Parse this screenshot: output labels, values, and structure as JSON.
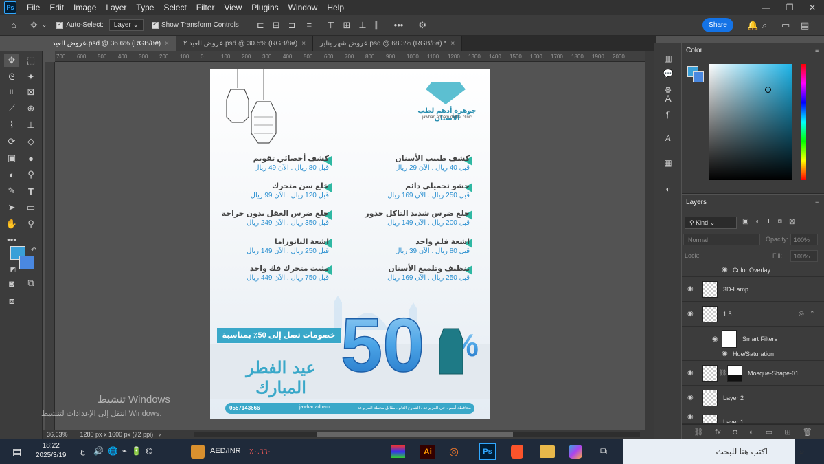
{
  "app": {
    "menu": [
      "File",
      "Edit",
      "Image",
      "Layer",
      "Type",
      "Select",
      "Filter",
      "View",
      "Plugins",
      "Window",
      "Help"
    ],
    "logo": "Ps"
  },
  "options": {
    "auto_select": "Auto-Select:",
    "target": "Layer",
    "transform": "Show Transform Controls",
    "more": "•••",
    "share": "Share"
  },
  "tabs": [
    {
      "label": "عروض العيد.psd @ 36.6% (RGB/8#)",
      "active": true
    },
    {
      "label": "عروض العيد ٢.psd @ 30.5% (RGB/8#)",
      "active": false
    },
    {
      "label": "عروض شهر يناير.psd @ 68.3% (RGB/8#) *",
      "active": false
    }
  ],
  "ruler": [
    "700",
    "600",
    "500",
    "400",
    "300",
    "200",
    "100",
    "0",
    "100",
    "200",
    "300",
    "400",
    "500",
    "600",
    "700",
    "800",
    "900",
    "1000",
    "1100",
    "1200",
    "1300",
    "1400",
    "1500",
    "1600",
    "1700",
    "1800",
    "1900",
    "2000"
  ],
  "status": {
    "zoom": "36.63%",
    "info": "1280 px x 1600 px (72 ppi)"
  },
  "document": {
    "brand_ar": "جوهرة أدهم لطب الأسنان",
    "brand_en": "jawhart adham dental clinic",
    "offers_right": [
      {
        "title": "كشف طبيب الأسنان",
        "price": "قبل 40 ريال . الآن 29 ريال"
      },
      {
        "title": "حشو تجميلي دائم",
        "price": "قبل 250 ريال . الآن 169 ريال"
      },
      {
        "title": "خلع ضرس شديد التاكل جذور",
        "price": "قبل 200 ريال . الآن 149 ريال"
      },
      {
        "title": "اشعة فلم واحد",
        "price": "قبل 80 ريال . الآن 39 ريال"
      },
      {
        "title": "تنظيف وتلميع الأسنان",
        "price": "قبل 250 ريال . الآن 169 ريال"
      }
    ],
    "offers_left": [
      {
        "title": "كشف أخصائي تقويم",
        "price": "قبل 80 ريال . الآن 49 ريال"
      },
      {
        "title": "خلع سن متحرك",
        "price": "قبل 120 ريال . الآن 99 ريال"
      },
      {
        "title": "خلع ضرس العقل بدون جراحة",
        "price": "قبل 350 ريال . الآن 249 ريال"
      },
      {
        "title": "اشعة البانوراما",
        "price": "قبل 250 ريال . الآن 149 ريال"
      },
      {
        "title": "مثبت متحرك فك واحد",
        "price": "قبل 750 ريال . الآن 449 ريال"
      }
    ],
    "discount_banner": "خصومات تصل إلى 50٪ بمناسبة",
    "big_number": "50",
    "percent": "%",
    "eid_text": "عيد الفطر المبارك",
    "phone": "0557143666",
    "handle": "jawhartadham",
    "address": "محافظة أضم . حي المزيرعة . الشارع العام . مقابل محطة المزيرعة"
  },
  "color_panel": {
    "title": "Color",
    "fg": "#3aa0d8",
    "bg": "#4a88e0"
  },
  "layers": {
    "title": "Layers",
    "kind": "Kind",
    "blend": "Normal",
    "opacity_label": "Opacity:",
    "opacity": "100%",
    "lock_label": "Lock:",
    "fill_label": "Fill:",
    "fill": "100%",
    "rows": [
      "Color Overlay",
      "3D-Lamp",
      "1.5",
      "Smart Filters",
      "Hue/Saturation",
      "Mosque-Shape-01",
      "Layer 2",
      "Layer 1"
    ]
  },
  "watermark": {
    "line1": "تنشيط Windows",
    "line2": "انتقل إلى الإعدادات لتنشيط Windows."
  },
  "taskbar": {
    "time": "18:22",
    "date": "2025/3/19",
    "lang": "ع",
    "ticker": "AED/INR",
    "ticker_val": "٪٠.٦٦-",
    "search": "اكتب هنا للبحث"
  }
}
